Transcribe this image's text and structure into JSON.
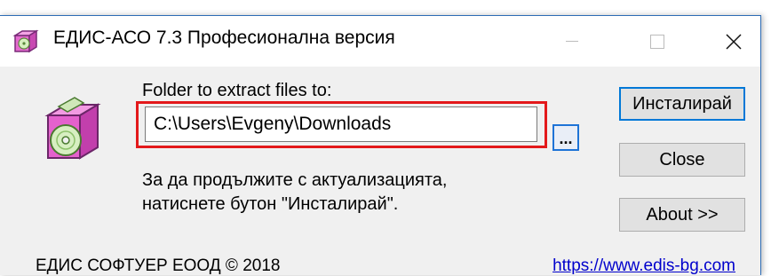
{
  "window": {
    "title": "ЕДИС-АСО 7.3 Професионална версия"
  },
  "dialog": {
    "extract_label": "Folder to extract files to:",
    "path_value": "C:\\Users\\Evgeny\\Downloads",
    "browse_label": "...",
    "hint_line1": "За да продължите с актуализацията,",
    "hint_line2": "натиснете бутон \"Инсталирай\"."
  },
  "buttons": {
    "install": "Инсталирай",
    "close": "Close",
    "about": "About >>"
  },
  "footer": {
    "copyright": "ЕДИС СОФТУЕР ЕООД © 2018",
    "link": "https://www.edis-bg.com"
  },
  "colors": {
    "highlight": "#e3191b",
    "link": "#0000cc",
    "focus": "#0078d7"
  },
  "icons": {
    "app_small": "installer-box-icon",
    "app_large": "installer-box-cd-icon"
  }
}
